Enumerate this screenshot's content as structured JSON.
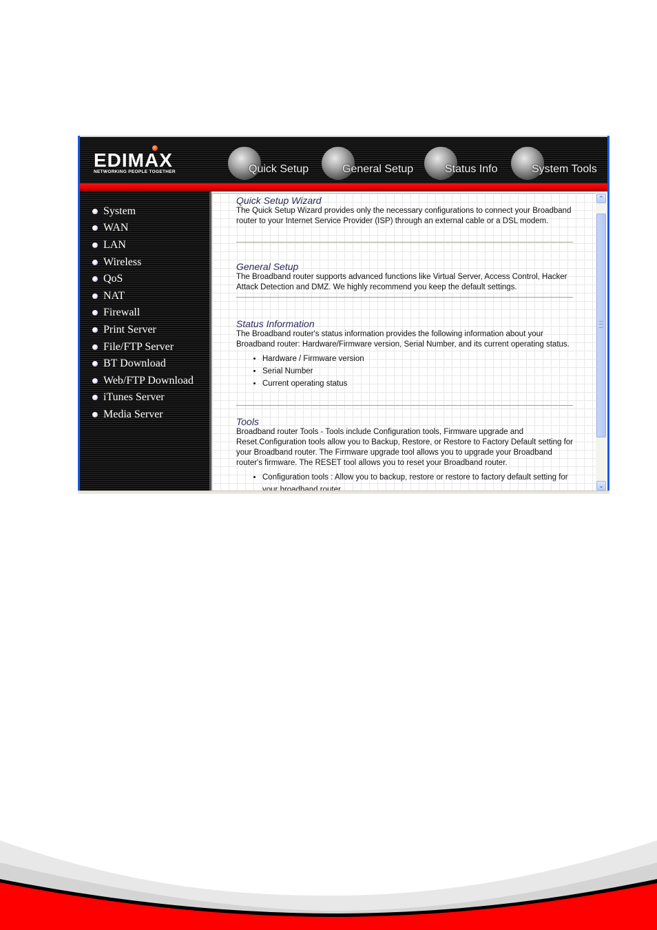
{
  "brand": {
    "name": "EDIMAX",
    "tagline": "NETWORKING PEOPLE TOGETHER"
  },
  "top_nav": [
    {
      "label": "Quick Setup",
      "icon": "quick-setup-globe-icon"
    },
    {
      "label": "General Setup",
      "icon": "general-setup-globe-icon"
    },
    {
      "label": "Status Info",
      "icon": "status-info-globe-icon"
    },
    {
      "label": "System Tools",
      "icon": "system-tools-globe-icon"
    }
  ],
  "sidebar": {
    "items": [
      {
        "label": "System"
      },
      {
        "label": "WAN"
      },
      {
        "label": "LAN"
      },
      {
        "label": "Wireless"
      },
      {
        "label": "QoS"
      },
      {
        "label": "NAT"
      },
      {
        "label": "Firewall"
      },
      {
        "label": "Print Server"
      },
      {
        "label": "File/FTP Server"
      },
      {
        "label": "BT Download"
      },
      {
        "label": "Web/FTP Download"
      },
      {
        "label": "iTunes Server"
      },
      {
        "label": "Media Server"
      }
    ]
  },
  "content": {
    "sections": [
      {
        "title": "Quick Setup Wizard",
        "text": "The Quick Setup Wizard provides only the necessary configurations to connect your Broadband router to your Internet Service Provider (ISP) through an external cable or a DSL modem."
      },
      {
        "title": "General Setup",
        "text": "The Broadband router supports advanced functions like Virtual Server, Access Control, Hacker Attack Detection and DMZ. We highly recommend you keep the default settings."
      },
      {
        "title": "Status Information",
        "text": "The Broadband router's status information provides the following information about your Broadband router: Hardware/Firmware version, Serial Number, and its current operating status.",
        "list": [
          "Hardware / Firmware version",
          "Serial Number",
          "Current operating status"
        ]
      },
      {
        "title": "Tools",
        "text": "Broadband router Tools - Tools include Configuration tools, Firmware upgrade and Reset.Configuration tools allow you to Backup, Restore, or Restore to Factory Default setting for your Broadband router. The Firmware upgrade tool allows you to upgrade your Broadband router's firmware. The RESET tool allows you to reset your Broadband router.",
        "list": [
          "Configuration tools : Allow you to backup, restore or restore to factory default setting for your broadband router"
        ]
      }
    ]
  },
  "scrollbar": {
    "up_glyph": "⌃",
    "down_glyph": "⌄"
  },
  "colors": {
    "accent_red": "#e00000",
    "heading_navy": "#2b2b5a",
    "window_frame_blue": "#1a5ad8"
  }
}
